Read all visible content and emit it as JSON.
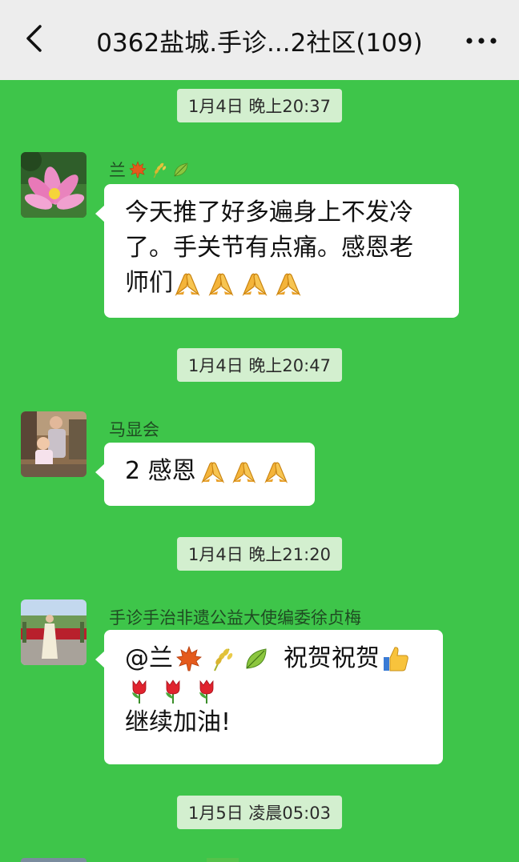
{
  "header": {
    "title": "0362盐城.手诊...2社区(109)",
    "back_icon": "chevron-left-icon",
    "more_icon": "more-dots-icon"
  },
  "messages": [
    {
      "time": "1月4日 晚上20:37",
      "sender": "兰",
      "sender_emojis": [
        "maple-leaf-icon",
        "rice-icon",
        "leaf-icon"
      ],
      "lines": [
        "今天推了好多遍身上不发冷",
        "了。手关节有点痛。感恩老",
        "师们"
      ],
      "trailing_emojis": [
        "pray-hands-icon",
        "pray-hands-icon",
        "pray-hands-icon",
        "pray-hands-icon"
      ],
      "avatar": "lotus-avatar"
    },
    {
      "time": "1月4日 晚上20:47",
      "sender": "马显会",
      "lines": [
        "2 感恩"
      ],
      "trailing_emojis": [
        "pray-hands-icon",
        "pray-hands-icon",
        "pray-hands-icon"
      ],
      "avatar": "family-photo-avatar"
    },
    {
      "time": "1月4日 晚上21:20",
      "sender": "手诊手治非遗公益大使编委徐贞梅",
      "line1_prefix": "@兰",
      "line1_mid": "祝贺祝贺",
      "line3": "继续加油!",
      "avatar": "garden-photo-avatar"
    }
  ],
  "next_time": "1月5日 凌晨05:03",
  "colors": {
    "background": "#3ec54a",
    "header": "#ededed",
    "time_chip": "#d3efcf",
    "bubble": "#ffffff"
  }
}
